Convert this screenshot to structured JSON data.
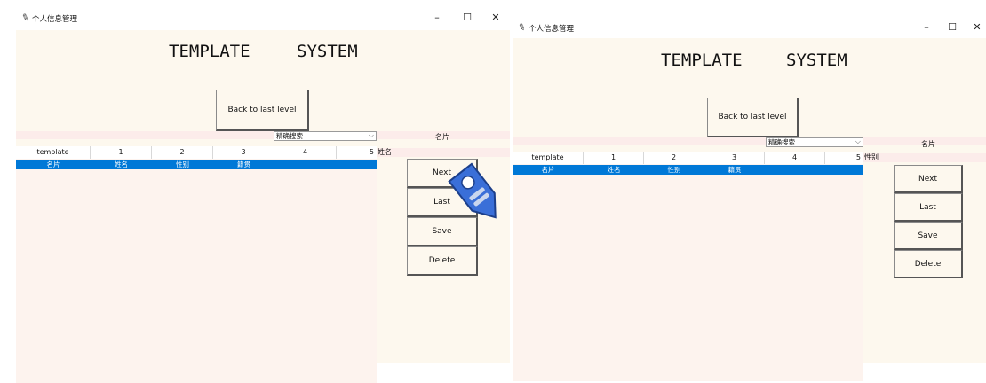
{
  "window_title": "个人信息管理",
  "controls": {
    "minimize": "–",
    "maximize": "☐",
    "close": "✕"
  },
  "heading": {
    "left": "TEMPLATE",
    "right": "SYSTEM"
  },
  "back_button": "Back to last level",
  "search_mode": "精确搜索",
  "card_header": "名片",
  "columns": [
    "template",
    "1",
    "2",
    "3",
    "4",
    "5"
  ],
  "selected_row": [
    "名片",
    "姓名",
    "性别",
    "籍贯",
    "",
    ""
  ],
  "left_window": {
    "field_label": "姓名",
    "buttons": [
      "Next",
      "Last",
      "Save",
      "Delete"
    ]
  },
  "right_window": {
    "field_label": "性别",
    "buttons": [
      "Next",
      "Last",
      "Save",
      "Delete"
    ]
  },
  "cursor": {
    "type": "tag-cursor",
    "color": "#3a6fd8"
  }
}
